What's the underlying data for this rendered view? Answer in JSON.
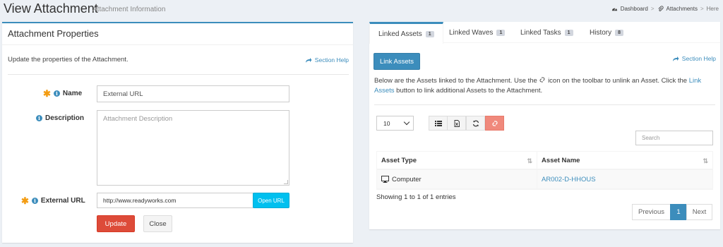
{
  "page": {
    "title": "View Attachment",
    "subtitle": "Attachment Information"
  },
  "breadcrumb": {
    "dashboard": "Dashboard",
    "sep1": ">",
    "attachments": "Attachments",
    "sep2": ">",
    "here": "Here"
  },
  "left_panel": {
    "title": "Attachment Properties",
    "description": "Update the properties of the Attachment.",
    "section_help": "Section Help",
    "name_label": "Name",
    "name_value": "External URL",
    "description_label": "Description",
    "description_placeholder": "Attachment Description",
    "url_label": "External URL",
    "url_value": "http://www.readyworks.com",
    "open_url": "Open URL",
    "update": "Update",
    "close": "Close"
  },
  "tabs": [
    {
      "label": "Linked Assets",
      "count": "1"
    },
    {
      "label": "Linked Waves",
      "count": "1"
    },
    {
      "label": "Linked Tasks",
      "count": "1"
    },
    {
      "label": "History",
      "count": "8"
    }
  ],
  "right_panel": {
    "link_assets": "Link Assets",
    "section_help": "Section Help",
    "para_a": "Below are the Assets linked to the Attachment. Use the",
    "para_b": "icon on the toolbar to unlink an Asset. Click the",
    "para_link": "Link Assets",
    "para_c": "button to link additional Assets to the Attachment.",
    "page_size": "10",
    "search_placeholder": "Search",
    "columns": [
      "Asset Type",
      "Asset Name"
    ],
    "rows": [
      {
        "type": "Computer",
        "name": "AR002-D-HHOUS"
      }
    ],
    "info": "Showing 1 to 1 of 1 entries",
    "pager": {
      "prev": "Previous",
      "current": "1",
      "next": "Next"
    }
  },
  "icons": [
    "tachometer-icon",
    "paperclip-icon",
    "share-icon",
    "info-icon",
    "unlink-icon",
    "list-icon",
    "file-excel-icon",
    "refresh-icon",
    "desktop-icon",
    "sort-icon"
  ],
  "colors": {
    "primary": "#3c8dbc",
    "danger": "#dd4b39",
    "info": "#00c0ef",
    "required": "#f39c12"
  }
}
